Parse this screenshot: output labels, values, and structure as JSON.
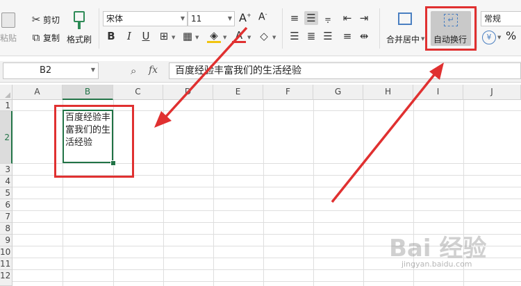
{
  "ribbon": {
    "paste_label": "粘贴",
    "cut_label": "剪切",
    "copy_label": "复制",
    "format_painter_label": "格式刷",
    "font_name": "宋体",
    "font_size": "11",
    "bold": "B",
    "italic": "I",
    "underline": "U",
    "font_color_glyph": "A",
    "grow_font": "A",
    "shrink_font": "A",
    "merge_center_label": "合并居中",
    "wrap_text_label": "自动换行",
    "number_format": "常规",
    "percent_glyph": "%",
    "currency_glyph": "¥"
  },
  "formula_bar": {
    "cell_reference": "B2",
    "function_label": "fx",
    "formula_value": "百度经验丰富我们的生活经验"
  },
  "sheet": {
    "columns": [
      "A",
      "B",
      "C",
      "D",
      "E",
      "F",
      "G",
      "H",
      "I",
      "J"
    ],
    "rows": [
      "1",
      "2",
      "3",
      "4",
      "5",
      "6",
      "7",
      "8",
      "9",
      "10",
      "11",
      "12"
    ],
    "selected_column": "B",
    "selected_row": "2",
    "cell_b2_text": "百度经验丰富我们的生活经验"
  },
  "watermark": {
    "text": "Bai 经验",
    "url": "jingyan.baidu.com"
  },
  "colors": {
    "selection_green": "#217346",
    "annotation_red": "#e03030",
    "wrap_button_bg": "#c9c9c9"
  }
}
